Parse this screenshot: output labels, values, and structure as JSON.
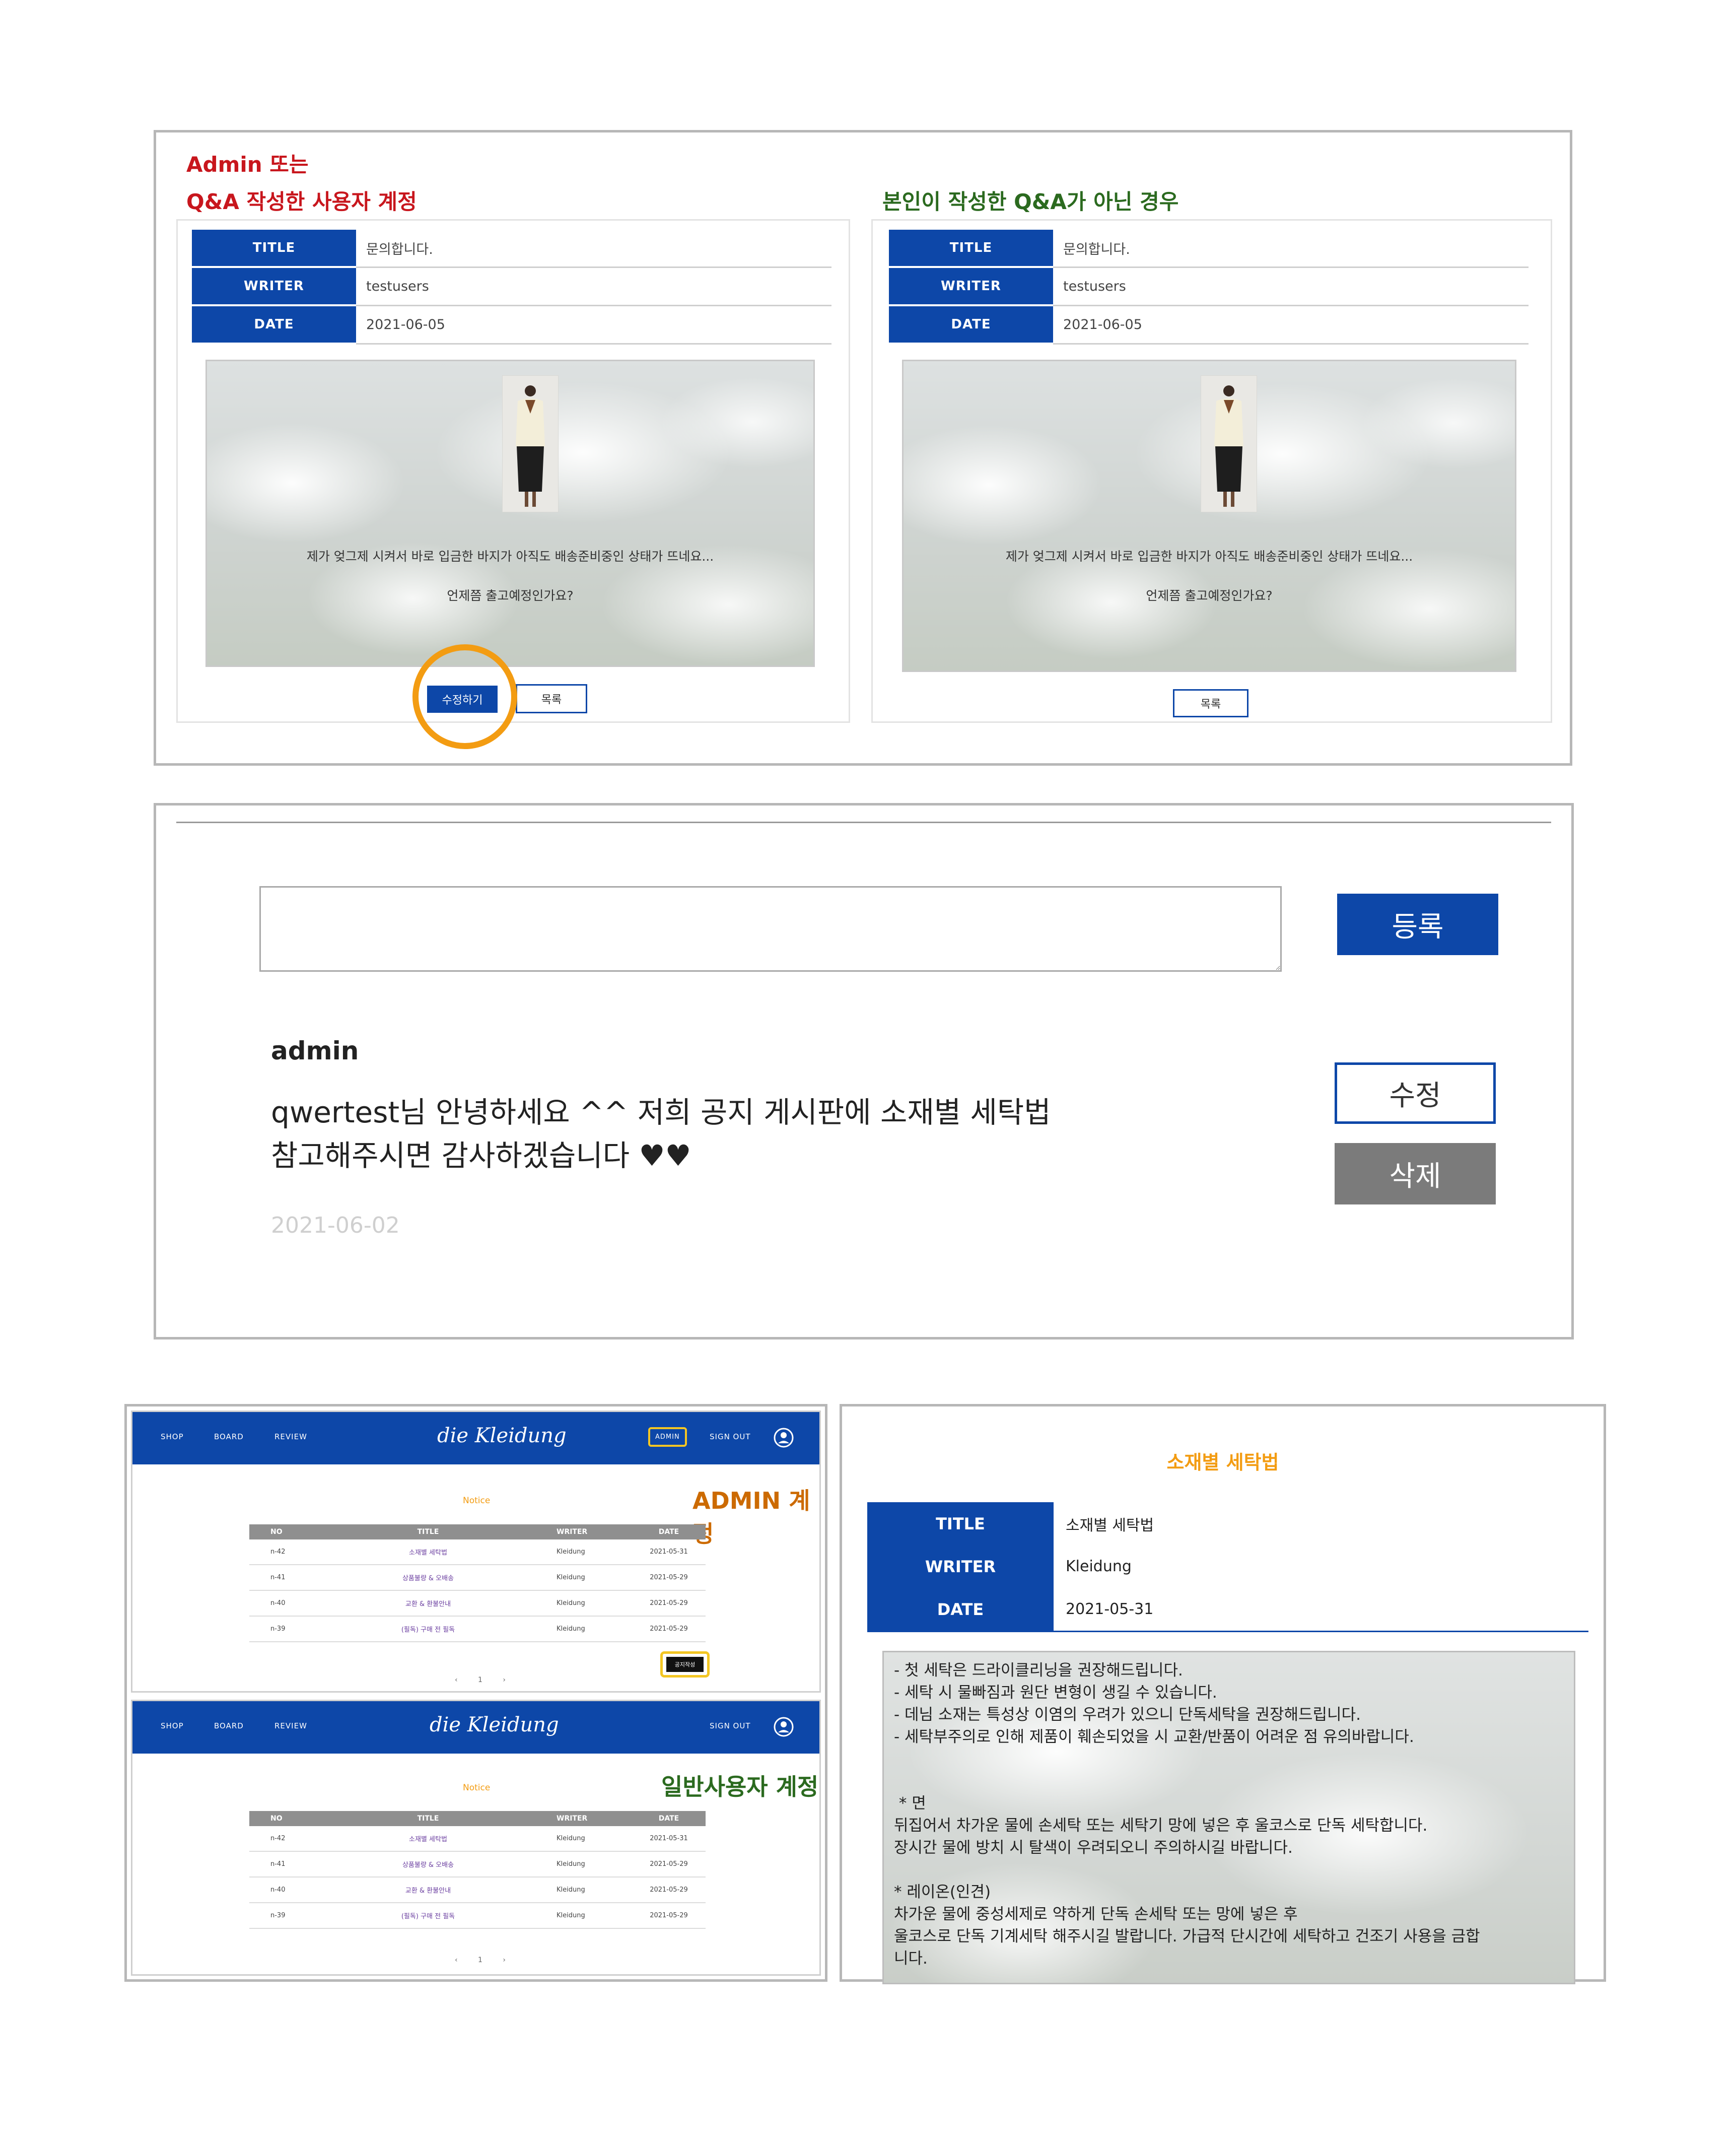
{
  "qa": {
    "admin_label_line1": "Admin 또는",
    "admin_label_line2": "Q&A 작성한 사용자 계정",
    "other_label": "본인이 작성한 Q&A가 아닌 경우",
    "headers": {
      "title": "TITLE",
      "writer": "WRITER",
      "date": "DATE"
    },
    "post": {
      "title": "문의합니다.",
      "writer": "testusers",
      "date": "2021-06-05",
      "body_line1": "제가 엊그제 시켜서 바로 입금한 바지가 아직도 배송준비중인 상태가 뜨네요...",
      "body_line2": "언제쯤 출고예정인가요?"
    },
    "edit_button": "수정하기",
    "list_button": "목록",
    "highlight_color": "#f39c12"
  },
  "comment": {
    "input_value": "",
    "register_button": "등록",
    "author": "admin",
    "text_line1": "qwertest님 안녕하세요 ^^ 저희 공지 게시판에 소재별 세탁법",
    "text_line2": "참고해주시면 감사하겠습니다 ♥♥",
    "date": "2021-06-02",
    "edit_button": "수정",
    "delete_button": "삭제"
  },
  "board": {
    "nav": {
      "shop": "SHOP",
      "board": "BOARD",
      "review": "REVIEW",
      "admin": "ADMIN",
      "signout": "SIGN OUT"
    },
    "logo": "die Kleidung",
    "section_title": "Notice",
    "admin_label": "ADMIN 계정",
    "user_label": "일반사용자 계정",
    "columns": [
      "NO",
      "TITLE",
      "WRITER",
      "DATE"
    ],
    "rows": [
      {
        "no": "n-42",
        "title": "소재별 세탁법",
        "writer": "Kleidung",
        "date": "2021-05-31"
      },
      {
        "no": "n-41",
        "title": "상품불량 & 오배송",
        "writer": "Kleidung",
        "date": "2021-05-29"
      },
      {
        "no": "n-40",
        "title": "교환 & 환불안내",
        "writer": "Kleidung",
        "date": "2021-05-29"
      },
      {
        "no": "n-39",
        "title": "(필독) 구매 전 필독",
        "writer": "Kleidung",
        "date": "2021-05-29"
      }
    ],
    "write_button": "공지작성",
    "pager": "‹ 1 ›",
    "primary_color": "#0d47a8"
  },
  "notice_detail": {
    "page_title": "소재별 세탁법",
    "headers": {
      "title": "TITLE",
      "writer": "WRITER",
      "date": "DATE"
    },
    "title": "소재별 세탁법",
    "writer": "Kleidung",
    "date": "2021-05-31",
    "body": [
      "- 첫 세탁은 드라이클리닝을 권장해드립니다.",
      "- 세탁 시 물빠짐과 원단 변형이 생길 수 있습니다.",
      "- 데님 소재는 특성상 이염의 우려가 있으니 단독세탁을 권장해드립니다.",
      "- 세탁부주의로 인해 제품이 훼손되었을 시 교환/반품이 어려운 점 유의바랍니다.",
      "",
      "",
      " * 면",
      "뒤집어서 차가운 물에 손세탁 또는 세탁기 망에 넣은 후 울코스로 단독 세탁합니다.",
      "장시간 물에 방치 시 탈색이 우려되오니 주의하시길 바랍니다.",
      "",
      "* 레이온(인견)",
      "차가운 물에 중성세제로 약하게 단독 손세탁 또는 망에 넣은 후",
      "울코스로 단독 기계세탁 해주시길 발랍니다. 가급적 단시간에 세탁하고 건조기 사용을 금합",
      "니다."
    ]
  }
}
